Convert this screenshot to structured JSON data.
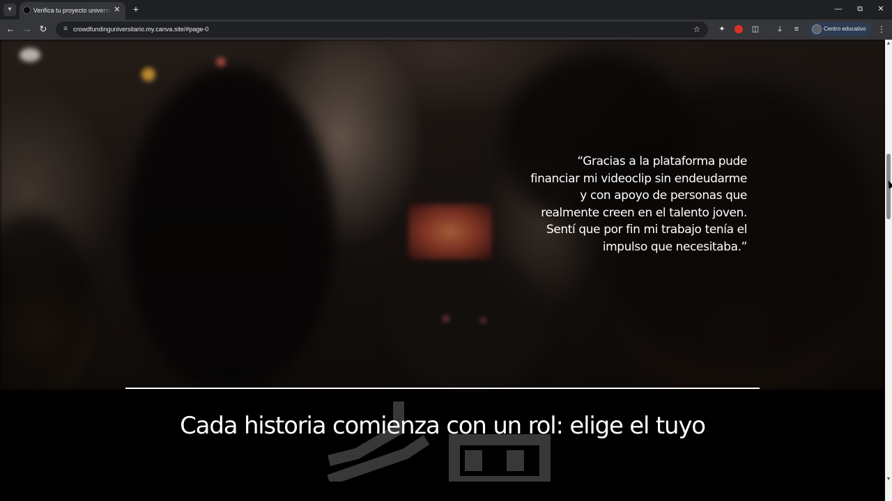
{
  "browser": {
    "tab": {
      "title": "Verifica tu proyecto universitario",
      "favicon": "canva-favicon-icon"
    },
    "new_tab_label": "+",
    "address_bar": {
      "url": "crowdfundinguniversitario.my.canva.site/#page-0"
    },
    "profile": {
      "label": "Centro educativo"
    },
    "icons": {
      "tab_list": "chevron-down-icon",
      "close_tab": "close-icon",
      "minimize": "minimize-icon",
      "restore": "restore-icon",
      "close_window": "close-icon",
      "back": "back-arrow-icon",
      "forward": "forward-arrow-icon",
      "reload": "reload-icon",
      "site_info": "tune-icon",
      "bookmark": "star-icon",
      "extension_1": "sparkle-icon",
      "extension_2": "record-icon",
      "extensions": "puzzle-icon",
      "downloads": "download-icon",
      "reading_list": "playlist-icon",
      "menu": "more-vert-icon"
    }
  },
  "page": {
    "quote": "“Gracias a la plataforma pude financiar mi videoclip sin endeudarme y con apoyo de personas que realmente creen en el talento joven. Sentí que por fin mi trabajo tenía el impulso que necesitaba.”",
    "headline": "Cada historia comienza con un rol: elige el tuyo"
  },
  "colors": {
    "tabbar_bg": "#1f2023",
    "toolbar_bg": "#35363a",
    "omnibox_bg": "#202124",
    "page_bg": "#000000",
    "text": "#ffffff",
    "profile_chip": "#2d3c52",
    "extension_red": "#d93025"
  }
}
